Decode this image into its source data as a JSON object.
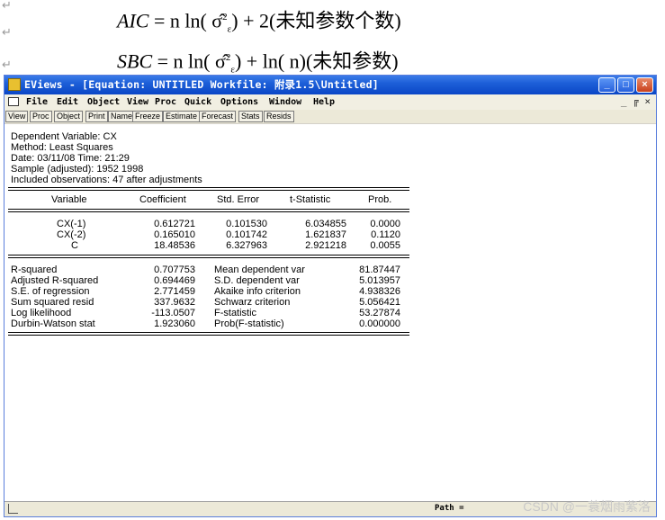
{
  "formulas": {
    "aic_lhs": "AIC",
    "aic_rhs": "= n ln( σ̂",
    "aic_rest": ") + 2(未知参数个数)",
    "sbc_lhs": "SBC",
    "sbc_rhs": "= n ln( σ̂",
    "sbc_rest": ") + ln( n)(未知参数)",
    "sub": "ε",
    "sup": "2"
  },
  "window": {
    "title": "EViews - [Equation: UNTITLED   Workfile: 附录1.5\\Untitled]",
    "menu": [
      "File",
      "Edit",
      "Object",
      "View",
      "Proc",
      "Quick",
      "Options",
      "Window",
      "Help"
    ],
    "menu_right": "_ ╔ ×",
    "toolbar": [
      "View",
      "Proc",
      "Object",
      "Print",
      "Name",
      "Freeze",
      "Estimate",
      "Forecast",
      "Stats",
      "Resids"
    ],
    "status_path": "Path = ",
    "watermark": "CSDN @一蓑烟雨紫洛"
  },
  "output": {
    "header": [
      "Dependent Variable: CX",
      "Method: Least Squares",
      "Date: 03/11/08   Time: 21:29",
      "Sample (adjusted): 1952 1998",
      "Included observations: 47 after adjustments"
    ],
    "coef_columns": [
      "Variable",
      "Coefficient",
      "Std. Error",
      "t-Statistic",
      "Prob."
    ],
    "coef_rows": [
      [
        "CX(-1)",
        "0.612721",
        "0.101530",
        "6.034855",
        "0.0000"
      ],
      [
        "CX(-2)",
        "0.165010",
        "0.101742",
        "1.621837",
        "0.1120"
      ],
      [
        "C",
        "18.48536",
        "6.327963",
        "2.921218",
        "0.0055"
      ]
    ],
    "stats_rows": [
      [
        "R-squared",
        "0.707753",
        "Mean dependent var",
        "81.87447"
      ],
      [
        "Adjusted R-squared",
        "0.694469",
        "S.D. dependent var",
        "5.013957"
      ],
      [
        "S.E. of regression",
        "2.771459",
        "Akaike info criterion",
        "4.938326"
      ],
      [
        "Sum squared resid",
        "337.9632",
        "Schwarz criterion",
        "5.056421"
      ],
      [
        "Log likelihood",
        "-113.0507",
        "F-statistic",
        "53.27874"
      ],
      [
        "Durbin-Watson stat",
        "1.923060",
        "Prob(F-statistic)",
        "0.000000"
      ]
    ]
  }
}
